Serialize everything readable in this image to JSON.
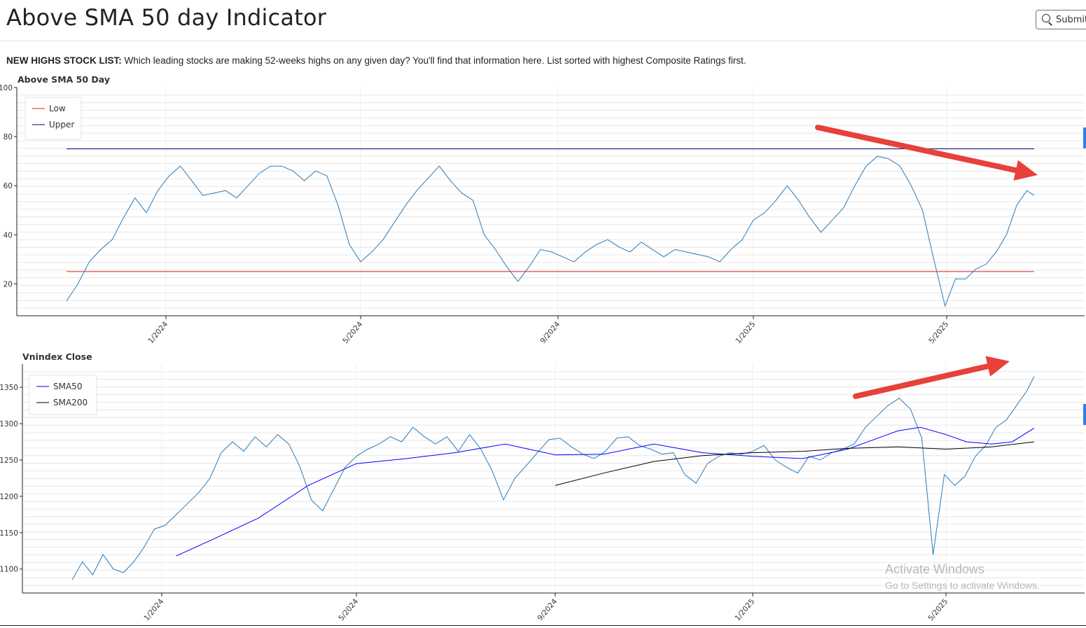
{
  "page": {
    "title": "Above SMA 50 day Indicator",
    "search_label": "Submit",
    "description_bold": "NEW HIGHS STOCK LIST:",
    "description_text": " Which leading stocks are making 52-weeks highs on any given day? You'll find that information here. List sorted with highest Composite Ratings first.",
    "watermark_title": "Activate Windows",
    "watermark_sub": "Go to Settings to activate Windows."
  },
  "colors": {
    "breadth": "#2b7bb9",
    "low": "#e41a1c",
    "upper": "#00007f",
    "sma50": "#0000ff",
    "sma200": "#000000",
    "arrow": "#e8403a",
    "grid": "#e6e6e6"
  },
  "chart_data": [
    {
      "type": "line",
      "title": "Above SMA 50 Day",
      "x_ticks": [
        "1/2024",
        "5/2024",
        "9/2024",
        "1/2025",
        "5/2025"
      ],
      "y_ticks": [
        "20",
        "40",
        "60",
        "80",
        "100"
      ],
      "ylim": [
        7,
        100
      ],
      "grid": true,
      "legend_position": "top-left",
      "series": [
        {
          "name": "Low",
          "color": "#e41a1c",
          "x": [
            "2023-11-01",
            "2025-06-30"
          ],
          "values": [
            25,
            25
          ]
        },
        {
          "name": "Upper",
          "color": "#00007f",
          "x": [
            "2023-11-01",
            "2025-06-30"
          ],
          "values": [
            75,
            75
          ]
        },
        {
          "color": "#2b7bb9",
          "x": [
            "2023-11-01",
            "2023-11-08",
            "2023-11-15",
            "2023-11-22",
            "2023-11-29",
            "2023-12-06",
            "2023-12-13",
            "2023-12-20",
            "2023-12-27",
            "2024-01-03",
            "2024-01-10",
            "2024-01-17",
            "2024-01-24",
            "2024-01-31",
            "2024-02-07",
            "2024-02-14",
            "2024-02-21",
            "2024-02-28",
            "2024-03-06",
            "2024-03-13",
            "2024-03-20",
            "2024-03-27",
            "2024-04-03",
            "2024-04-10",
            "2024-04-17",
            "2024-04-24",
            "2024-05-01",
            "2024-05-08",
            "2024-05-15",
            "2024-05-22",
            "2024-05-29",
            "2024-06-05",
            "2024-06-12",
            "2024-06-19",
            "2024-06-26",
            "2024-07-03",
            "2024-07-10",
            "2024-07-17",
            "2024-07-24",
            "2024-07-31",
            "2024-08-07",
            "2024-08-14",
            "2024-08-21",
            "2024-08-28",
            "2024-09-04",
            "2024-09-11",
            "2024-09-18",
            "2024-09-25",
            "2024-10-02",
            "2024-10-09",
            "2024-10-16",
            "2024-10-23",
            "2024-10-30",
            "2024-11-06",
            "2024-11-13",
            "2024-11-20",
            "2024-11-27",
            "2024-12-04",
            "2024-12-11",
            "2024-12-18",
            "2024-12-25",
            "2025-01-01",
            "2025-01-08",
            "2025-01-15",
            "2025-01-22",
            "2025-01-29",
            "2025-02-05",
            "2025-02-12",
            "2025-02-19",
            "2025-02-26",
            "2025-03-05",
            "2025-03-12",
            "2025-03-19",
            "2025-03-26",
            "2025-04-02",
            "2025-04-09",
            "2025-04-16",
            "2025-04-23",
            "2025-04-30",
            "2025-05-07",
            "2025-05-14",
            "2025-05-21",
            "2025-05-28",
            "2025-06-04",
            "2025-06-11",
            "2025-06-18",
            "2025-06-25",
            "2025-06-30"
          ],
          "values": [
            13,
            20,
            29,
            34,
            38,
            47,
            55,
            49,
            58,
            64,
            68,
            62,
            56,
            57,
            58,
            55,
            60,
            65,
            68,
            68,
            66,
            62,
            66,
            64,
            52,
            36,
            29,
            33,
            38,
            45,
            52,
            58,
            63,
            68,
            62,
            57,
            54,
            40,
            34,
            27,
            21,
            27,
            34,
            33,
            31,
            29,
            33,
            36,
            38,
            35,
            33,
            37,
            34,
            31,
            34,
            33,
            32,
            31,
            29,
            34,
            38,
            46,
            49,
            54,
            60,
            54,
            47,
            41,
            46,
            51,
            60,
            68,
            72,
            71,
            68,
            60,
            50,
            30,
            11,
            22,
            22,
            26,
            28,
            33,
            40,
            52,
            58,
            56
          ]
        }
      ]
    },
    {
      "type": "line",
      "title": "Vnindex Close",
      "x_ticks": [
        "1/2024",
        "5/2024",
        "9/2024",
        "1/2025",
        "5/2025"
      ],
      "y_ticks": [
        "1100",
        "1150",
        "1200",
        "1250",
        "1300",
        "1350"
      ],
      "ylim": [
        1067,
        1382
      ],
      "grid": true,
      "legend_position": "top-left",
      "series": [
        {
          "color": "#2b7bb9",
          "x": [
            "2023-11-01",
            "2023-11-08",
            "2023-11-15",
            "2023-11-22",
            "2023-11-29",
            "2023-12-06",
            "2023-12-13",
            "2023-12-20",
            "2023-12-27",
            "2024-01-03",
            "2024-01-10",
            "2024-01-17",
            "2024-01-24",
            "2024-01-31",
            "2024-02-07",
            "2024-02-14",
            "2024-02-21",
            "2024-02-28",
            "2024-03-06",
            "2024-03-13",
            "2024-03-20",
            "2024-03-27",
            "2024-04-03",
            "2024-04-10",
            "2024-04-17",
            "2024-04-24",
            "2024-05-01",
            "2024-05-08",
            "2024-05-15",
            "2024-05-22",
            "2024-05-29",
            "2024-06-05",
            "2024-06-12",
            "2024-06-19",
            "2024-06-26",
            "2024-07-03",
            "2024-07-10",
            "2024-07-17",
            "2024-07-24",
            "2024-07-31",
            "2024-08-07",
            "2024-08-14",
            "2024-08-21",
            "2024-08-28",
            "2024-09-04",
            "2024-09-11",
            "2024-09-18",
            "2024-09-25",
            "2024-10-02",
            "2024-10-09",
            "2024-10-16",
            "2024-10-23",
            "2024-10-30",
            "2024-11-06",
            "2024-11-13",
            "2024-11-20",
            "2024-11-27",
            "2024-12-04",
            "2024-12-11",
            "2024-12-18",
            "2024-12-25",
            "2025-01-01",
            "2025-01-08",
            "2025-01-15",
            "2025-01-22",
            "2025-01-29",
            "2025-02-05",
            "2025-02-12",
            "2025-02-19",
            "2025-02-26",
            "2025-03-05",
            "2025-03-12",
            "2025-03-19",
            "2025-03-26",
            "2025-04-02",
            "2025-04-09",
            "2025-04-16",
            "2025-04-23",
            "2025-04-30",
            "2025-05-07",
            "2025-05-14",
            "2025-05-21",
            "2025-05-28",
            "2025-06-04",
            "2025-06-11",
            "2025-06-18",
            "2025-06-25",
            "2025-06-30"
          ],
          "values": [
            1085,
            1110,
            1092,
            1120,
            1100,
            1095,
            1110,
            1130,
            1155,
            1160,
            1175,
            1190,
            1205,
            1225,
            1260,
            1275,
            1262,
            1282,
            1268,
            1285,
            1272,
            1240,
            1195,
            1180,
            1210,
            1240,
            1255,
            1265,
            1272,
            1282,
            1275,
            1295,
            1282,
            1272,
            1282,
            1262,
            1285,
            1265,
            1235,
            1195,
            1225,
            1242,
            1260,
            1278,
            1280,
            1268,
            1258,
            1252,
            1262,
            1280,
            1282,
            1270,
            1265,
            1258,
            1260,
            1230,
            1218,
            1245,
            1255,
            1260,
            1258,
            1262,
            1270,
            1250,
            1240,
            1232,
            1255,
            1250,
            1260,
            1265,
            1272,
            1295,
            1310,
            1325,
            1335,
            1320,
            1280,
            1120,
            1230,
            1215,
            1228,
            1255,
            1270,
            1295,
            1305,
            1325,
            1345,
            1365
          ]
        },
        {
          "name": "SMA50",
          "color": "#0000ff",
          "x": [
            "2024-01-10",
            "2024-02-01",
            "2024-03-01",
            "2024-04-01",
            "2024-05-01",
            "2024-06-01",
            "2024-07-01",
            "2024-08-01",
            "2024-09-01",
            "2024-10-01",
            "2024-11-01",
            "2024-12-01",
            "2025-01-01",
            "2025-02-01",
            "2025-03-01",
            "2025-04-01",
            "2025-04-15",
            "2025-05-01",
            "2025-05-15",
            "2025-06-01",
            "2025-06-15",
            "2025-06-30"
          ],
          "values": [
            1118,
            1140,
            1170,
            1215,
            1245,
            1252,
            1260,
            1272,
            1257,
            1258,
            1272,
            1260,
            1255,
            1252,
            1265,
            1290,
            1295,
            1285,
            1275,
            1272,
            1275,
            1294
          ]
        },
        {
          "name": "SMA200",
          "color": "#000000",
          "x": [
            "2024-09-01",
            "2024-10-01",
            "2024-11-01",
            "2024-12-01",
            "2025-01-01",
            "2025-02-01",
            "2025-03-01",
            "2025-04-01",
            "2025-05-01",
            "2025-06-01",
            "2025-06-30"
          ],
          "values": [
            1215,
            1232,
            1248,
            1256,
            1260,
            1262,
            1266,
            1268,
            1265,
            1268,
            1275
          ]
        }
      ]
    }
  ]
}
